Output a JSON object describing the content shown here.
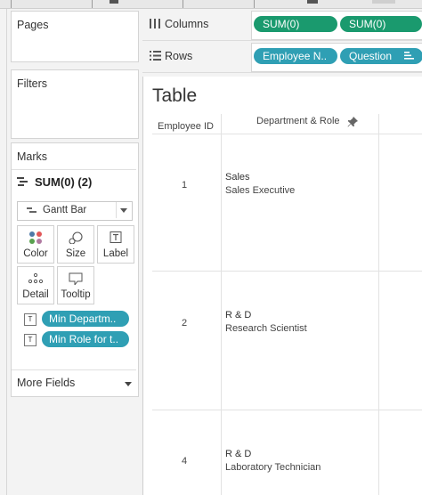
{
  "panels": {
    "pages_title": "Pages",
    "filters_title": "Filters",
    "marks_title": "Marks",
    "marks_summary": "SUM(0) (2)",
    "mark_type": "Gantt Bar",
    "buttons": {
      "color": "Color",
      "size": "Size",
      "label": "Label",
      "detail": "Detail",
      "tooltip": "Tooltip"
    },
    "mark_fields": [
      "Min Departm..",
      "Min Role for t.."
    ],
    "more_fields": "More Fields"
  },
  "shelves": {
    "columns_label": "Columns",
    "columns_pills": [
      "SUM(0)",
      "SUM(0)"
    ],
    "rows_label": "Rows",
    "rows_pills": [
      "Employee N..",
      "Question"
    ]
  },
  "view": {
    "title": "Table",
    "headers": [
      "Employee ID",
      "Department & Role"
    ],
    "rows": [
      {
        "id": "1",
        "department": "Sales",
        "role": "Sales Executive"
      },
      {
        "id": "2",
        "department": "R & D",
        "role": "Research Scientist"
      },
      {
        "id": "4",
        "department": "R & D",
        "role": "Laboratory Technician"
      }
    ]
  },
  "colors": {
    "pill_teal": "#2f9fb4",
    "pill_green": "#1a9a6e"
  }
}
